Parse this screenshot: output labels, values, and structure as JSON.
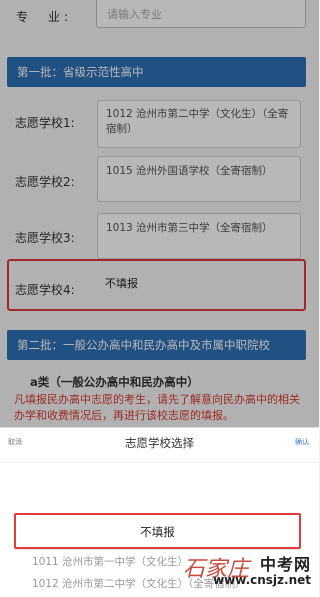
{
  "form": {
    "major_label": "专　业:",
    "major_placeholder": "请输入专业",
    "section1_title": "第一批：省级示范性高中",
    "schools": [
      {
        "label": "志愿学校1:",
        "value": "1012 沧州市第二中学（文化生）（全寄宿制）"
      },
      {
        "label": "志愿学校2:",
        "value": "1015 沧州外国语学校（全寄宿制）"
      },
      {
        "label": "志愿学校3:",
        "value": "1013 沧州市第三中学（全寄宿制）"
      },
      {
        "label": "志愿学校4:",
        "value": "不填报"
      }
    ],
    "section2_title": "第二批：一般公办高中和民办高中及市属中职院校",
    "category_a_title": "a类（一般公办高中和民办高中）",
    "notice": "凡填报民办高中志愿的考生，请先了解意向民办高中的相关办学和收费情况后，再进行该校志愿的填报。"
  },
  "picker": {
    "cancel_label": "取消",
    "title": "志愿学校选择",
    "confirm_label": "确认",
    "selected_option": "不填报",
    "options_below": [
      "1011 沧州市第一中学（文化生）",
      "1012 沧州市第二中学（文化生）（全寄宿制）"
    ]
  },
  "watermark": {
    "site_cn": "中考网",
    "site_url": "www.cnsjz.net",
    "script_mark": "石家庄"
  }
}
